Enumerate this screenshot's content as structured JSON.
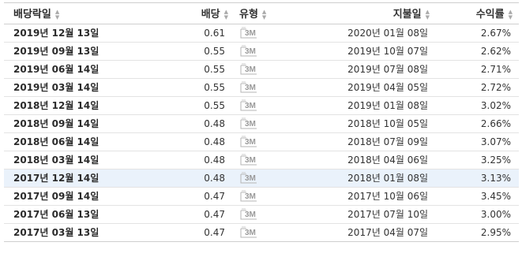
{
  "headers": {
    "ex_date": "배당락일",
    "dividend": "배당",
    "type": "유형",
    "pay_date": "지불일",
    "yield": "수익률"
  },
  "sort_icon": "sort-updown-icon",
  "highlight_color": "#eaf2fb",
  "rows": [
    {
      "ex_date": "2019년 12월 13일",
      "dividend": "0.61",
      "type": "3M",
      "pay_date": "2020년 01월 08일",
      "yield": "2.67%"
    },
    {
      "ex_date": "2019년 09월 13일",
      "dividend": "0.55",
      "type": "3M",
      "pay_date": "2019년 10월 07일",
      "yield": "2.62%"
    },
    {
      "ex_date": "2019년 06월 14일",
      "dividend": "0.55",
      "type": "3M",
      "pay_date": "2019년 07월 08일",
      "yield": "2.71%"
    },
    {
      "ex_date": "2019년 03월 14일",
      "dividend": "0.55",
      "type": "3M",
      "pay_date": "2019년 04월 05일",
      "yield": "2.72%"
    },
    {
      "ex_date": "2018년 12월 14일",
      "dividend": "0.55",
      "type": "3M",
      "pay_date": "2019년 01월 08일",
      "yield": "3.02%"
    },
    {
      "ex_date": "2018년 09월 14일",
      "dividend": "0.48",
      "type": "3M",
      "pay_date": "2018년 10월 05일",
      "yield": "2.66%"
    },
    {
      "ex_date": "2018년 06월 14일",
      "dividend": "0.48",
      "type": "3M",
      "pay_date": "2018년 07월 09일",
      "yield": "3.07%"
    },
    {
      "ex_date": "2018년 03월 14일",
      "dividend": "0.48",
      "type": "3M",
      "pay_date": "2018년 04월 06일",
      "yield": "3.25%"
    },
    {
      "ex_date": "2017년 12월 14일",
      "dividend": "0.48",
      "type": "3M",
      "pay_date": "2018년 01월 08일",
      "yield": "3.13%",
      "highlighted": true
    },
    {
      "ex_date": "2017년 09월 14일",
      "dividend": "0.47",
      "type": "3M",
      "pay_date": "2017년 10월 06일",
      "yield": "3.45%"
    },
    {
      "ex_date": "2017년 06월 13일",
      "dividend": "0.47",
      "type": "3M",
      "pay_date": "2017년 07월 10일",
      "yield": "3.00%"
    },
    {
      "ex_date": "2017년 03월 13일",
      "dividend": "0.47",
      "type": "3M",
      "pay_date": "2017년 04월 07일",
      "yield": "2.95%"
    }
  ]
}
